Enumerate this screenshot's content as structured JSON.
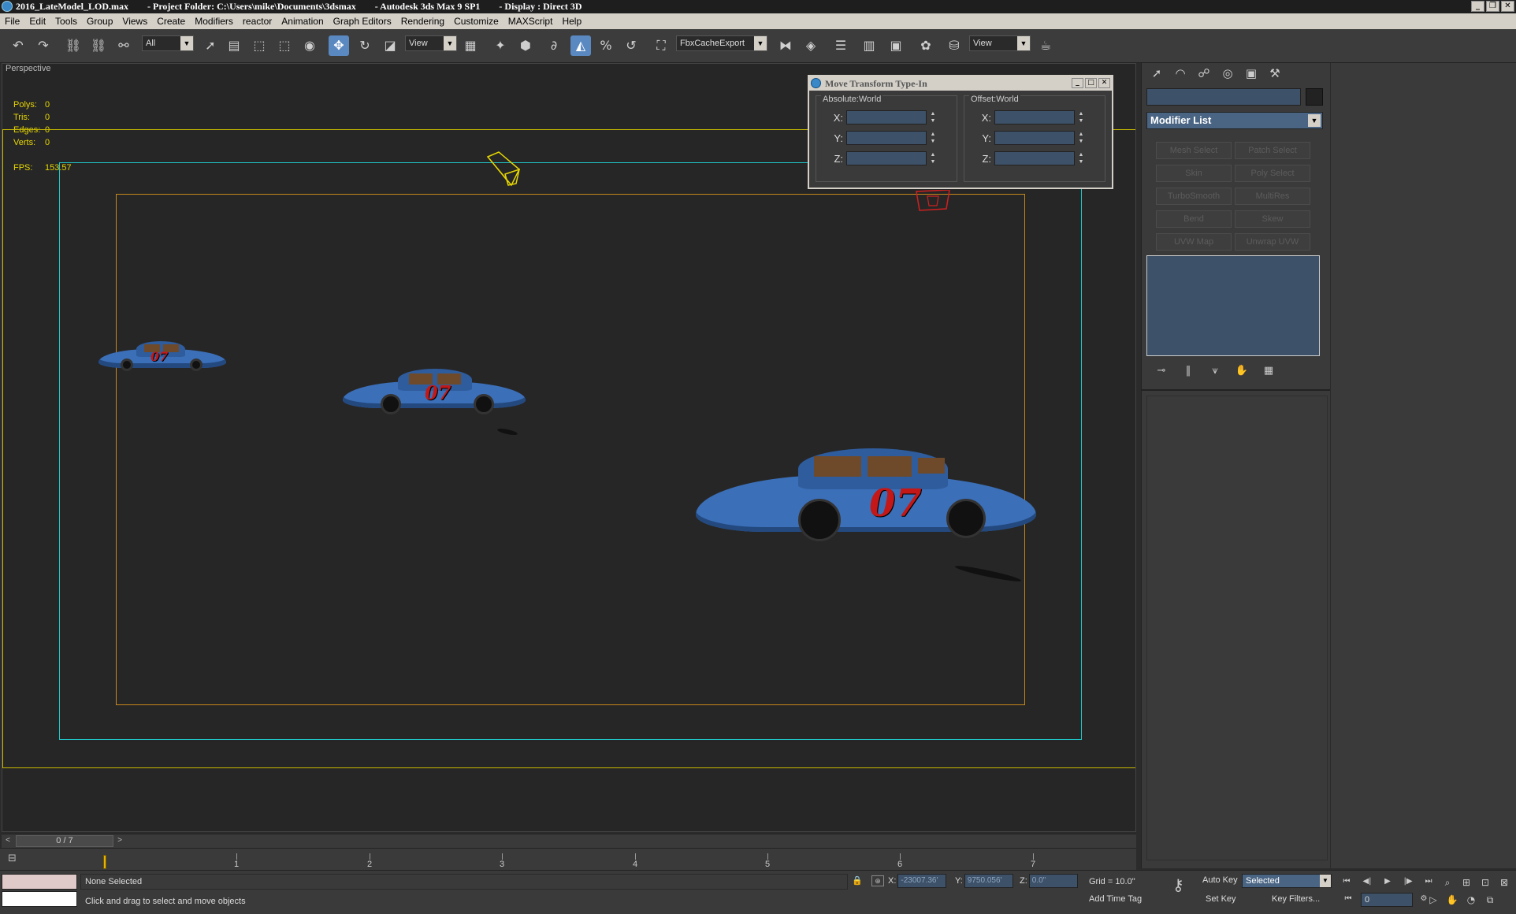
{
  "window": {
    "file": "2016_LateModel_LOD.max",
    "project": "- Project Folder: C:\\Users\\mike\\Documents\\3dsmax",
    "app": "- Autodesk 3ds Max 9 SP1",
    "display": "- Display : Direct 3D"
  },
  "menu": [
    "File",
    "Edit",
    "Tools",
    "Group",
    "Views",
    "Create",
    "Modifiers",
    "reactor",
    "Animation",
    "Graph Editors",
    "Rendering",
    "Customize",
    "MAXScript",
    "Help"
  ],
  "toolbar": {
    "selection_filter": "All",
    "ref_coord": "View",
    "named_selection": "FbxCacheExport",
    "render_view": "View"
  },
  "viewport": {
    "label": "Perspective",
    "stats": {
      "polys_label": "Polys:",
      "polys": "0",
      "tris_label": "Tris:",
      "tris": "0",
      "edges_label": "Edges:",
      "edges": "0",
      "verts_label": "Verts:",
      "verts": "0",
      "fps_label": "FPS:",
      "fps": "153.57"
    },
    "car_number": "07",
    "colors": {
      "car_blue": "#3b6fb8",
      "frame_yellow": "#c8b800",
      "frame_cyan": "#1fc8c8",
      "frame_orange": "#c8881c"
    }
  },
  "dialog": {
    "title": "Move Transform Type-In",
    "absolute": {
      "label": "Absolute:World",
      "x_label": "X:",
      "y_label": "Y:",
      "z_label": "Z:"
    },
    "offset": {
      "label": "Offset:World",
      "x_label": "X:",
      "y_label": "Y:",
      "z_label": "Z:"
    }
  },
  "command_panel": {
    "modifier_list": "Modifier List",
    "modifier_buttons": [
      "Mesh Select",
      "Patch Select",
      "Skin",
      "Poly Select",
      "TurboSmooth",
      "MultiRes",
      "Bend",
      "Skew",
      "UVW Map",
      "Unwrap UVW"
    ]
  },
  "time_slider": {
    "position": "0 / 7"
  },
  "trackbar": {
    "ticks": [
      "1",
      "2",
      "3",
      "4",
      "5",
      "6",
      "7"
    ]
  },
  "status": {
    "selection": "None Selected",
    "prompt": "Click and drag to select and move objects",
    "x_label": "X:",
    "x_value": "-23007.36'",
    "y_label": "Y:",
    "y_value": "9750.056'",
    "z_label": "Z:",
    "z_value": "0.0\"",
    "grid": "Grid = 10.0\"",
    "add_time_tag": "Add Time Tag",
    "auto_key": "Auto Key",
    "set_key": "Set Key",
    "key_mode": "Selected",
    "key_filters": "Key Filters...",
    "current_frame": "0"
  }
}
